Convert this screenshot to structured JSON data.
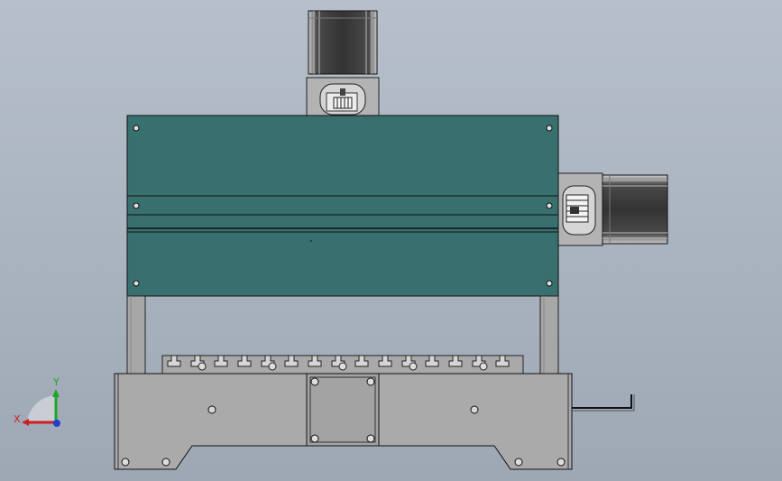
{
  "viewport": {
    "background_top": "#b6bfca",
    "background_bottom": "#9ea8b4"
  },
  "model": {
    "gantry_color": "#37706e",
    "frame_color": "#a9a9a9",
    "motor_color": "#3a3a3a",
    "edge_color": "#1a1a1a"
  },
  "triad": {
    "x_label": "X",
    "y_label": "Y",
    "x_color": "#cc1f1f",
    "y_color": "#1fa52a",
    "z_color": "#1f3fcc"
  }
}
